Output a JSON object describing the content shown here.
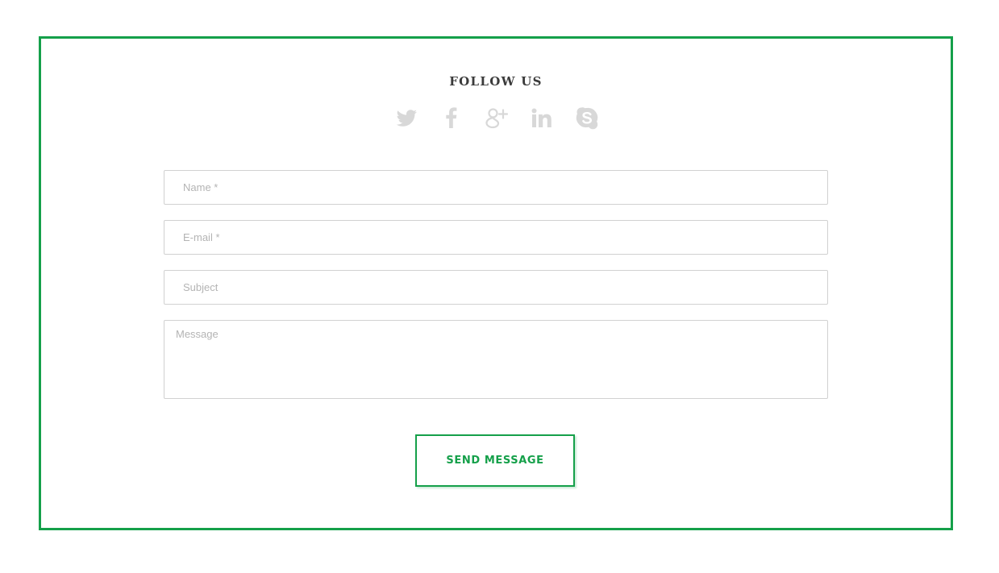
{
  "follow": {
    "title": "FOLLOW US",
    "icons": [
      "twitter-icon",
      "facebook-icon",
      "google-plus-icon",
      "linkedin-icon",
      "skype-icon"
    ],
    "icon_color": "#d8d8d8"
  },
  "form": {
    "name_placeholder": "Name *",
    "email_placeholder": "E-mail *",
    "subject_placeholder": "Subject",
    "message_placeholder": "Message",
    "submit_label": "SEND MESSAGE"
  },
  "colors": {
    "accent": "#15a04a",
    "heading": "#3b3b3b",
    "border": "#d1d1d1",
    "placeholder": "#b4b4b4"
  }
}
